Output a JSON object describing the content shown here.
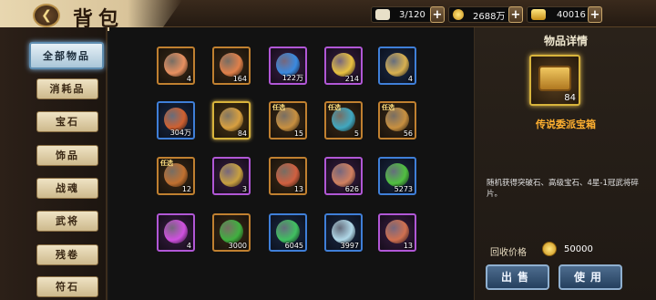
{
  "header": {
    "title": "背包",
    "back_icon": "back-arrow-icon",
    "bag_capacity": "3/120",
    "silver": "2688万",
    "gold": "40016"
  },
  "sidebar": {
    "items": [
      {
        "label": "全部物品",
        "active": true
      },
      {
        "label": "消耗品"
      },
      {
        "label": "宝石"
      },
      {
        "label": "饰品"
      },
      {
        "label": "战魂"
      },
      {
        "label": "武将"
      },
      {
        "label": "残卷"
      },
      {
        "label": "符石"
      }
    ]
  },
  "grid": {
    "items": [
      {
        "icon": "crystal-egg-icon",
        "count": "4",
        "rarity": "orange",
        "color": "#e89060"
      },
      {
        "icon": "peach-icon",
        "count": "164",
        "rarity": "orange",
        "color": "#e0804a"
      },
      {
        "icon": "blue-egg-icon",
        "count": "122万",
        "rarity": "purple",
        "color": "#3a8ae0"
      },
      {
        "icon": "gold-coin-icon",
        "count": "214",
        "rarity": "purple",
        "color": "#e8c040"
      },
      {
        "icon": "scroll-token-icon",
        "count": "4",
        "rarity": "blue",
        "color": "#d8b050"
      },
      {
        "icon": "jade-seal-icon",
        "count": "304万",
        "rarity": "blue",
        "color": "#d06030"
      },
      {
        "icon": "legend-chest-icon",
        "count": "84",
        "rarity": "gold",
        "color": "#d8a040"
      },
      {
        "icon": "selectable-chest-icon",
        "count": "15",
        "rarity": "orange",
        "color": "#c89040",
        "tag": "任选"
      },
      {
        "icon": "selectable-chest-icon",
        "count": "5",
        "rarity": "orange",
        "color": "#40a8c0",
        "tag": "任选"
      },
      {
        "icon": "selectable-chest-icon",
        "count": "56",
        "rarity": "orange",
        "color": "#c89040",
        "tag": "任选"
      },
      {
        "icon": "selectable-chest-icon",
        "count": "12",
        "rarity": "orange",
        "color": "#c07030",
        "tag": "任选"
      },
      {
        "icon": "hay-bundle-icon",
        "count": "3",
        "rarity": "purple",
        "color": "#c8a040"
      },
      {
        "icon": "dragon-chest-icon",
        "count": "13",
        "rarity": "orange",
        "color": "#d06040"
      },
      {
        "icon": "meat-bread-icon",
        "count": "626",
        "rarity": "purple",
        "color": "#d08060"
      },
      {
        "icon": "green-orb-icon",
        "count": "5273",
        "rarity": "blue",
        "color": "#50c040"
      },
      {
        "icon": "purple-orb-icon",
        "count": "4",
        "rarity": "purple",
        "color": "#d050e0"
      },
      {
        "icon": "paw-medal-icon",
        "count": "3000",
        "rarity": "orange",
        "color": "#40b040"
      },
      {
        "icon": "green-gem-icon",
        "count": "6045",
        "rarity": "blue",
        "color": "#40c060"
      },
      {
        "icon": "white-crystal-icon",
        "count": "3997",
        "rarity": "blue",
        "color": "#b0d8e8"
      },
      {
        "icon": "hero-fragment-icon",
        "count": "13",
        "rarity": "purple",
        "color": "#d07050"
      }
    ]
  },
  "detail": {
    "title": "物品详情",
    "item_icon": "legend-chest-icon",
    "item_count": "84",
    "item_name": "传说委派宝箱",
    "description": "随机获得突破石、高级宝石、4星-1冠武将碎片。",
    "price_label": "回收价格",
    "price_value": "50000",
    "sell_label": "出售",
    "use_label": "使用"
  }
}
